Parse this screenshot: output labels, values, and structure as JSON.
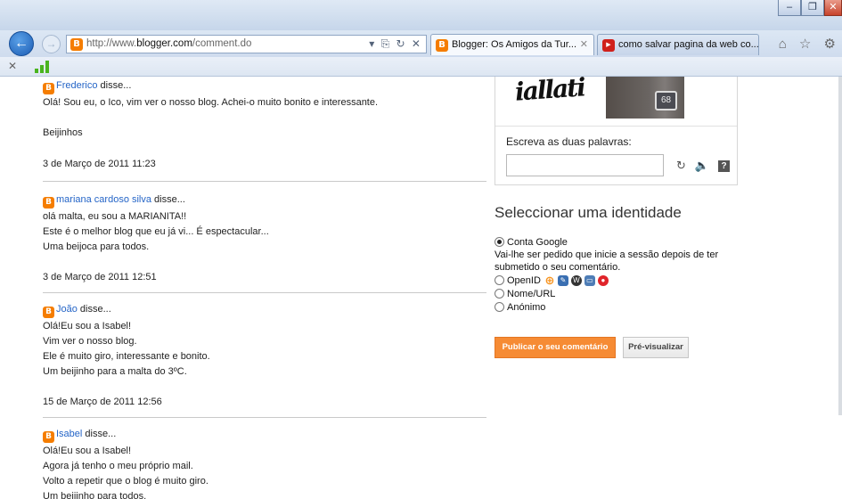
{
  "browser": {
    "window_controls": [
      "–",
      "❐",
      "✕"
    ],
    "url_prefix": "http://www.",
    "url_domain": "blogger.com",
    "url_path": "/comment.do",
    "address_tools": "▾ ⎘ ↻ ✕",
    "tabs": [
      {
        "label": "Blogger: Os Amigos da Tur...",
        "close": "✕",
        "active": true
      },
      {
        "label": "como salvar pagina da web co...",
        "active": false
      }
    ],
    "toolbar_icons": "⌂ ☆ ⚙",
    "command_bar_close": "✕"
  },
  "comments": [
    {
      "author": "Frederico",
      "says": " disse...",
      "lines": [
        "Olá! Sou eu, o Ico, vim ver o nosso blog. Achei-o muito bonito e interessante.",
        "",
        "Beijinhos"
      ],
      "timestamp": "3 de Março de 2011 11:23"
    },
    {
      "author": "mariana cardoso silva",
      "says": " disse...",
      "lines": [
        "olá malta, eu sou a MARIANITA!!",
        "Este é o melhor blog que eu já vi... É espectacular...",
        "Uma beijoca para todos."
      ],
      "timestamp": "3 de Março de 2011 12:51"
    },
    {
      "author": "João",
      "says": " disse...",
      "lines": [
        "Olá!Eu sou a Isabel!",
        "Vim ver o nosso blog.",
        "Ele é muito giro, interessante e bonito.",
        "Um beijinho para a malta do 3ºC."
      ],
      "timestamp": "15 de Março de 2011 12:56"
    },
    {
      "author": "Isabel",
      "says": " disse...",
      "lines": [
        "Olá!Eu sou a Isabel!",
        "Agora já tenho o meu próprio mail.",
        "Volto a repetir que o blog é muito giro.",
        "Um beijinho para todos."
      ]
    }
  ],
  "captcha": {
    "image_text": "iallati",
    "photo_number": "68",
    "label": "Escreva as duas palavras:",
    "input_value": "",
    "refresh_icon": "↻",
    "audio_icon": "🔈",
    "help_icon": "?"
  },
  "identity": {
    "heading": "Seleccionar uma identidade",
    "options": [
      {
        "label": "Conta Google",
        "checked": true
      },
      {
        "label": "OpenID",
        "checked": false
      },
      {
        "label": "Nome/URL",
        "checked": false
      },
      {
        "label": "Anónimo",
        "checked": false
      }
    ],
    "note_line1": "Vai-lhe ser pedido que inicie a sessão depois de ter",
    "note_line2": "submetido o seu comentário."
  },
  "buttons": {
    "publish": "Publicar o seu comentário",
    "preview": "Pré-visualizar"
  }
}
